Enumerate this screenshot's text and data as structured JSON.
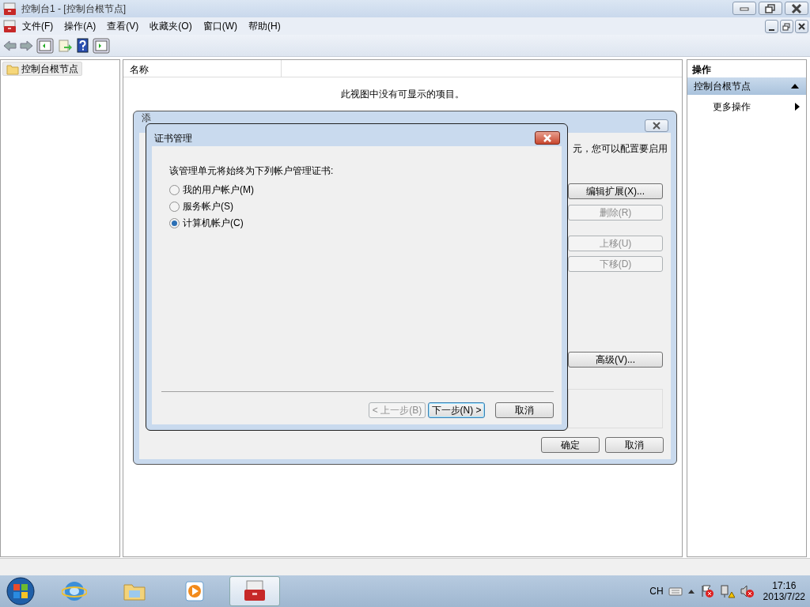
{
  "window": {
    "title": "控制台1 - [控制台根节点]",
    "menu": [
      "文件(F)",
      "操作(A)",
      "查看(V)",
      "收藏夹(O)",
      "窗口(W)",
      "帮助(H)"
    ]
  },
  "tree": {
    "items": [
      {
        "label": "控制台根节点",
        "selected": true
      }
    ]
  },
  "list": {
    "columns": [
      "名称"
    ],
    "empty_message": "此视图中没有可显示的项目。"
  },
  "actions": {
    "title": "操作",
    "sections": [
      {
        "label": "控制台根节点",
        "expanded": true,
        "items": [
          {
            "label": "更多操作"
          }
        ]
      }
    ]
  },
  "back_dialog": {
    "title": "添",
    "text": "元，您可以配置要启用",
    "buttons": [
      {
        "label": "编辑扩展(X)...",
        "disabled": false
      },
      {
        "label": "删除(R)",
        "disabled": true
      },
      {
        "label": "上移(U)",
        "disabled": true
      },
      {
        "label": "下移(D)",
        "disabled": true
      },
      {
        "label": "高级(V)...",
        "disabled": false
      }
    ],
    "footer_buttons": [
      {
        "label": "确定"
      },
      {
        "label": "取消"
      }
    ]
  },
  "front_dialog": {
    "title": "证书管理",
    "prompt": "该管理单元将始终为下列帐户管理证书:",
    "options": [
      {
        "label": "我的用户帐户(M)",
        "selected": false
      },
      {
        "label": "服务帐户(S)",
        "selected": false
      },
      {
        "label": "计算机帐户(C)",
        "selected": true
      }
    ],
    "buttons": [
      {
        "label": "< 上一步(B)",
        "disabled": true,
        "default": false
      },
      {
        "label": "下一步(N) >",
        "disabled": false,
        "default": true
      },
      {
        "label": "取消",
        "disabled": false,
        "default": false
      }
    ]
  },
  "taskbar": {
    "apps": [
      {
        "kind": "browser",
        "active": false
      },
      {
        "kind": "folder",
        "active": false
      },
      {
        "kind": "media",
        "active": false
      },
      {
        "kind": "console",
        "active": true
      }
    ],
    "language": "CH",
    "time": "17:16",
    "date": "2013/7/22"
  }
}
